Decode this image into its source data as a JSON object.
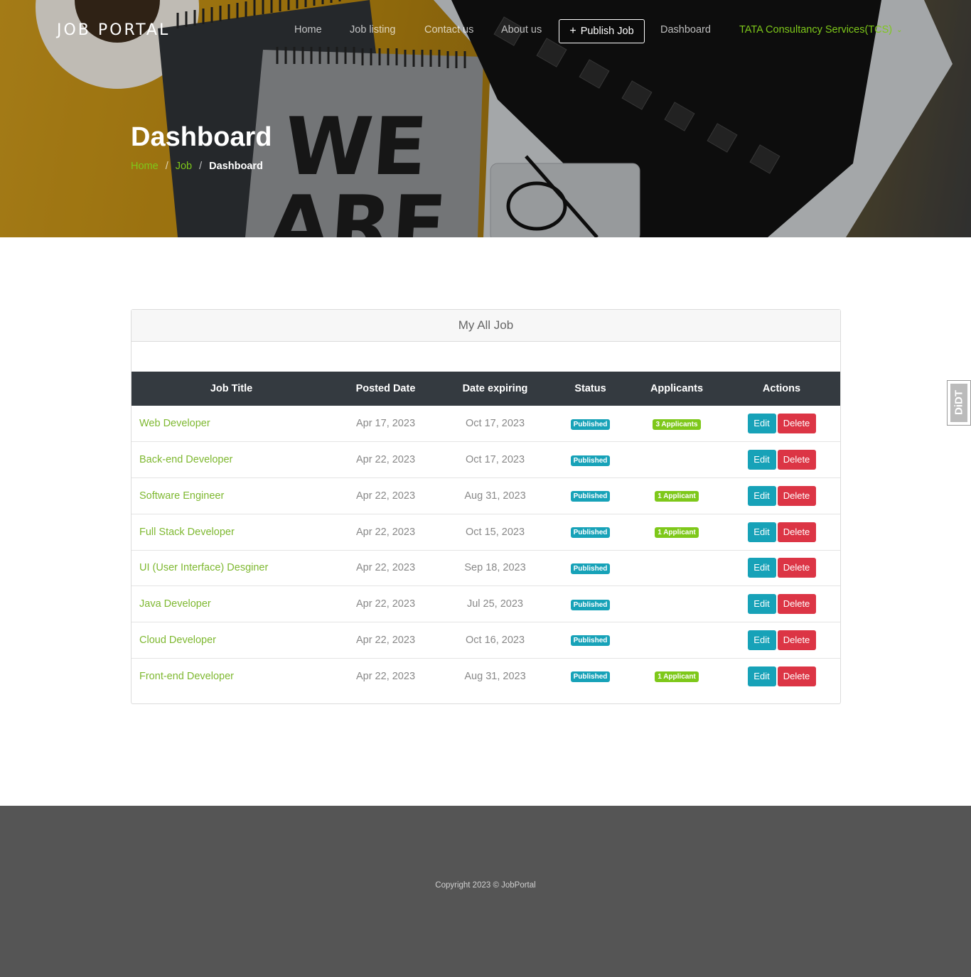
{
  "nav": {
    "brand": "JOB PORTAL",
    "home": "Home",
    "job_listing": "Job listing",
    "contact": "Contact us",
    "about": "About us",
    "publish": "Publish Job",
    "dashboard": "Dashboard",
    "company": "TATA Consultancy Services(TCS)"
  },
  "hero": {
    "title": "Dashboard",
    "breadcrumb": [
      "Home",
      "Job",
      "Dashboard"
    ],
    "poster_text_1": "WE",
    "poster_text_2": "ARE"
  },
  "card": {
    "title": "My All Job",
    "headers": [
      "Job Title",
      "Posted Date",
      "Date expiring",
      "Status",
      "Applicants",
      "Actions"
    ],
    "edit_label": "Edit",
    "delete_label": "Delete",
    "rows": [
      {
        "title": "Web Developer",
        "posted": "Apr 17, 2023",
        "expiring": "Oct 17, 2023",
        "status": "Published",
        "applicants": "3 Applicants"
      },
      {
        "title": "Back-end Developer",
        "posted": "Apr 22, 2023",
        "expiring": "Oct 17, 2023",
        "status": "Published",
        "applicants": ""
      },
      {
        "title": "Software Engineer",
        "posted": "Apr 22, 2023",
        "expiring": "Aug 31, 2023",
        "status": "Published",
        "applicants": "1 Applicant"
      },
      {
        "title": "Full Stack Developer",
        "posted": "Apr 22, 2023",
        "expiring": "Oct 15, 2023",
        "status": "Published",
        "applicants": "1 Applicant"
      },
      {
        "title": "UI (User Interface) Desginer",
        "posted": "Apr 22, 2023",
        "expiring": "Sep 18, 2023",
        "status": "Published",
        "applicants": ""
      },
      {
        "title": "Java Developer",
        "posted": "Apr 22, 2023",
        "expiring": "Jul 25, 2023",
        "status": "Published",
        "applicants": ""
      },
      {
        "title": "Cloud Developer",
        "posted": "Apr 22, 2023",
        "expiring": "Oct 16, 2023",
        "status": "Published",
        "applicants": ""
      },
      {
        "title": "Front-end Developer",
        "posted": "Apr 22, 2023",
        "expiring": "Aug 31, 2023",
        "status": "Published",
        "applicants": "1 Applicant"
      }
    ]
  },
  "side_widget": "DiDT",
  "footer": {
    "copyright": "Copyright 2023 © JobPortal"
  },
  "colors": {
    "accent_green": "#7ec81a",
    "status_badge": "#17a2b8",
    "delete_red": "#dc3545",
    "table_header": "#343a40",
    "footer_bg": "#555555"
  }
}
